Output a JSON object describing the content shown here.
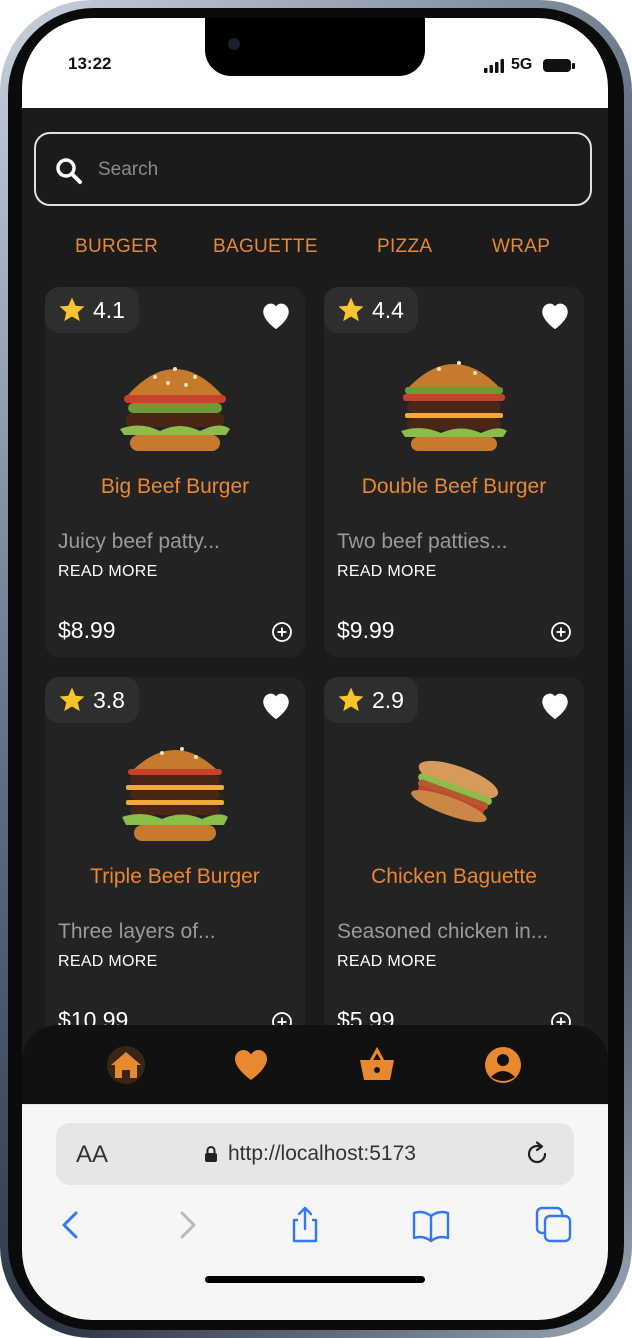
{
  "status_bar": {
    "time": "13:22",
    "network": "5G",
    "icons": [
      "signal-icon",
      "battery-icon"
    ]
  },
  "search": {
    "placeholder": "Search",
    "icon": "search-icon"
  },
  "categories": [
    "BURGER",
    "BAGUETTE",
    "PIZZA",
    "WRAP"
  ],
  "products": [
    {
      "name": "Big Beef Burger",
      "rating": "4.1",
      "description": "Juicy beef patty...",
      "read_more": "READ MORE",
      "price": "$8.99"
    },
    {
      "name": "Double Beef Burger",
      "rating": "4.4",
      "description": "Two beef patties...",
      "read_more": "READ MORE",
      "price": "$9.99"
    },
    {
      "name": "Triple Beef Burger",
      "rating": "3.8",
      "description": "Three layers of...",
      "read_more": "READ MORE",
      "price": "$10.99"
    },
    {
      "name": "Chicken Baguette",
      "rating": "2.9",
      "description": "Seasoned chicken in...",
      "read_more": "READ MORE",
      "price": "$5.99"
    }
  ],
  "bottom_nav": [
    "home-icon",
    "heart-icon",
    "basket-icon",
    "user-icon"
  ],
  "browser": {
    "reader_label": "AA",
    "url": "http://localhost:5173",
    "toolbar_icons": [
      "back-icon",
      "forward-icon",
      "share-icon",
      "bookmarks-icon",
      "tabs-icon"
    ]
  },
  "colors": {
    "accent": "#e8892f",
    "background": "#1b1b1c",
    "card": "#232323",
    "star": "#f7c52b"
  }
}
